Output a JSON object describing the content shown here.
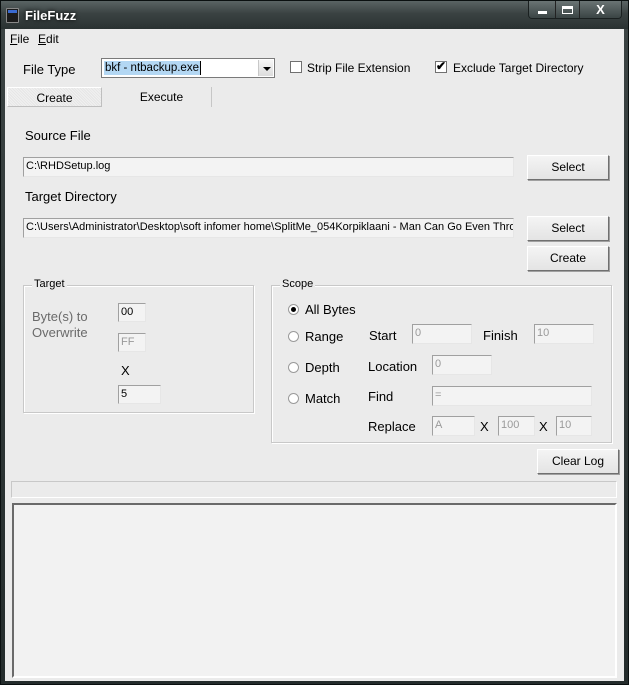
{
  "window": {
    "title": "FileFuzz",
    "controls": {
      "minimize": "minimize",
      "maximize": "maximize",
      "close": "X"
    }
  },
  "menu": [
    {
      "accel": "F",
      "rest": "ile"
    },
    {
      "accel": "E",
      "rest": "dit"
    }
  ],
  "options": {
    "file_type_label": "File Type",
    "file_type_value": "bkf - ntbackup.exe",
    "strip_ext_label": "Strip File Extension",
    "strip_ext_checked": false,
    "exclude_target_label": "Exclude Target Directory",
    "exclude_target_checked": true,
    "check_glyph": "✔"
  },
  "tabs": [
    {
      "label": "Create",
      "active": true
    },
    {
      "label": "Execute",
      "active": false
    }
  ],
  "source": {
    "label": "Source File",
    "value": "C:\\RHDSetup.log",
    "select_label": "Select"
  },
  "target_dir": {
    "label": "Target Directory",
    "value": "C:\\Users\\Administrator\\Desktop\\soft infomer home\\SplitMe_054Korpiklaani - Man Can Go Even Thro",
    "select_label": "Select",
    "create_label": "Create"
  },
  "target_group": {
    "title": "Target",
    "bytes_label_line1": "Byte(s) to",
    "bytes_label_line2": "Overwrite",
    "byte_value": "00",
    "byte_value2": "FF",
    "x_label": "X",
    "multiplier": "5"
  },
  "scope_group": {
    "title": "Scope",
    "selected": "All Bytes",
    "options": [
      {
        "label": "All Bytes",
        "checked": true
      },
      {
        "label": "Range",
        "checked": false
      },
      {
        "label": "Depth",
        "checked": false
      },
      {
        "label": "Match",
        "checked": false
      }
    ],
    "range": {
      "start_label": "Start",
      "start_value": "0",
      "finish_label": "Finish",
      "finish_value": "10"
    },
    "depth": {
      "location_label": "Location",
      "location_value": "0"
    },
    "match": {
      "find_label": "Find",
      "find_value": "=",
      "replace_label": "Replace",
      "replace_value": "A",
      "x1": "X",
      "count": "100",
      "x2": "X",
      "repeat": "10"
    }
  },
  "log": {
    "clear_label": "Clear Log",
    "status_text": "",
    "content": ""
  }
}
